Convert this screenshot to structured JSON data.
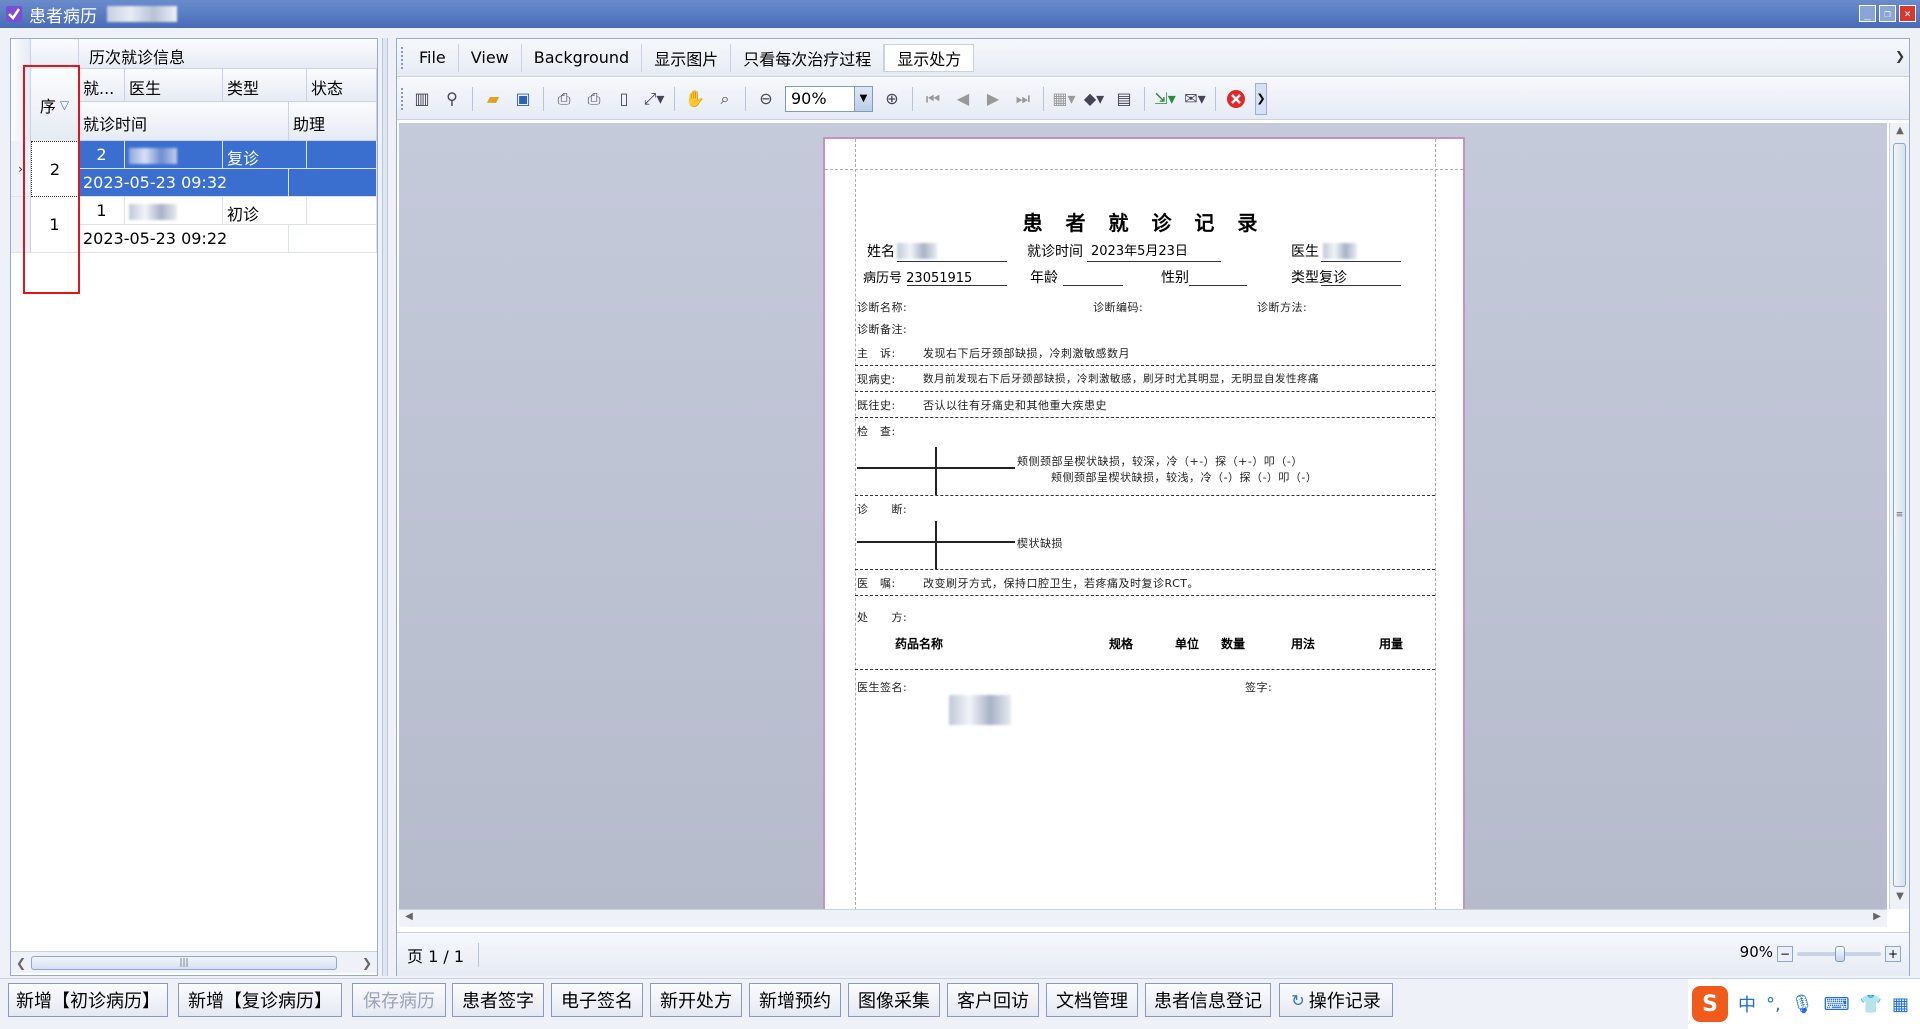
{
  "window": {
    "title": "患者病历"
  },
  "left": {
    "group_header": "历次就诊信息",
    "columns": {
      "seq": "序",
      "visit": "就...",
      "doctor": "医生",
      "type": "类型",
      "status": "状态",
      "visit_time": "就诊时间",
      "assistant": "助理"
    },
    "rows": [
      {
        "seq": "2",
        "visit": "2",
        "type": "复诊",
        "visit_time": "2023-05-23 09:32",
        "selected": true
      },
      {
        "seq": "1",
        "visit": "1",
        "type": "初诊",
        "visit_time": "2023-05-23 09:22",
        "selected": false
      }
    ]
  },
  "menu": [
    "File",
    "View",
    "Background",
    "显示图片",
    "只看每次治疗过程",
    "显示处方"
  ],
  "toolbar": {
    "zoom_value": "90%"
  },
  "document": {
    "title": "患 者 就 诊 记 录",
    "name_label": "姓名",
    "visit_time_label": "就诊时间",
    "visit_time_value": "2023年5月23日",
    "doctor_label": "医生",
    "record_no_label": "病历号",
    "record_no_value": "23051915",
    "age_label": "年龄",
    "gender_label": "性别",
    "type_label": "类型",
    "type_value": "复诊",
    "diag_name": "诊断名称:",
    "diag_code": "诊断编码:",
    "diag_method": "诊断方法:",
    "diag_note": "诊断备注:",
    "complaint_label": "主　诉:",
    "complaint": "发现右下后牙颈部缺损，冷刺激敏感数月",
    "history_label": "现病史:",
    "history": "数月前发现右下后牙颈部缺损，冷刺激敏感，刷牙时尤其明显，无明显自发性疼痛",
    "past_label": "既往史:",
    "past": "否认以往有牙痛史和其他重大疾患史",
    "exam_label": "检　查:",
    "exam_line1": "颊侧颈部呈楔状缺损，较深，冷（+-）探（+-）叩（-）",
    "exam_line2": "颊侧颈部呈楔状缺损，较浅，冷（-）探（-）叩（-）",
    "diagnosis_label": "诊　　断:",
    "diagnosis": "楔状缺损",
    "advice_label": "医　嘱:",
    "advice": "改变刷牙方式，保持口腔卫生，若疼痛及时复诊RCT。",
    "rx_label": "处　　方:",
    "rx_cols": [
      "药品名称",
      "规格",
      "单位",
      "数量",
      "用法",
      "用量"
    ],
    "doctor_sign_label": "医生签名:",
    "sign_label": "签字:"
  },
  "status": {
    "page_info": "页 1 / 1",
    "zoom": "90%"
  },
  "bottom_buttons": [
    {
      "label": "新增【初诊病历】",
      "enabled": true
    },
    {
      "label": "新增【复诊病历】",
      "enabled": true
    },
    {
      "label": "保存病历",
      "enabled": false
    },
    {
      "label": "患者签字",
      "enabled": true
    },
    {
      "label": "电子签名",
      "enabled": true
    },
    {
      "label": "新开处方",
      "enabled": true
    },
    {
      "label": "新增预约",
      "enabled": true
    },
    {
      "label": "图像采集",
      "enabled": true
    },
    {
      "label": "客户回访",
      "enabled": true
    },
    {
      "label": "文档管理",
      "enabled": true
    },
    {
      "label": "患者信息登记",
      "enabled": true
    },
    {
      "label": "操作记录",
      "enabled": true
    }
  ],
  "ime": {
    "mode": "中"
  },
  "colors": {
    "selection": "#3a6fd0",
    "highlight_box": "#e0161b",
    "title_bar": "#4a6cb8"
  }
}
